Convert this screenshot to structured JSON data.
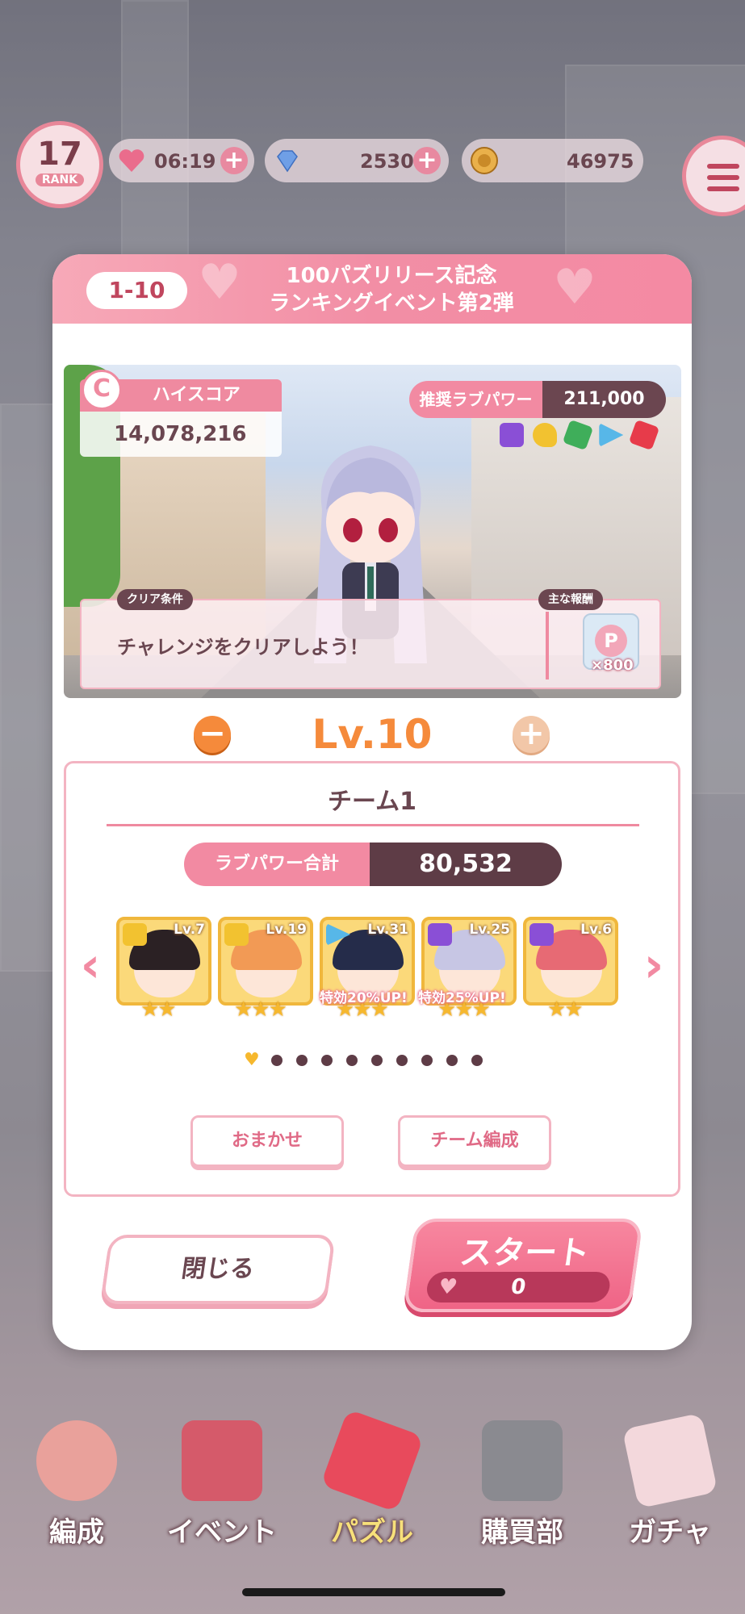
{
  "hud": {
    "rank_value": "17",
    "rank_label": "RANK",
    "stamina": "06:19",
    "gems": "2530",
    "coins": "46975"
  },
  "modal": {
    "stage": "1-10",
    "title_line1": "100パズリリース記念",
    "title_line2": "ランキングイベント第2弾",
    "highscore_label": "ハイスコア",
    "highscore_rank": "C",
    "highscore_value": "14,078,216",
    "recommended_label": "推奨ラブパワー",
    "recommended_value": "211,000",
    "clear_tag": "クリア条件",
    "clear_text": "チャレンジをクリアしよう！",
    "reward_tag": "主な報酬",
    "reward_icon": "P",
    "reward_amount": "×800",
    "level": "Lv.10",
    "team_name": "チーム1",
    "power_label": "ラブパワー合計",
    "power_value": "80,532",
    "cards": [
      {
        "level": "Lv.7",
        "stars": "★★",
        "boost": ""
      },
      {
        "level": "Lv.19",
        "stars": "★★★",
        "boost": ""
      },
      {
        "level": "Lv.31",
        "stars": "★★★",
        "boost": "特効20%UP!"
      },
      {
        "level": "Lv.25",
        "stars": "★★★",
        "boost": "特効25%UP!"
      },
      {
        "level": "Lv.6",
        "stars": "★★",
        "boost": ""
      }
    ],
    "auto_button": "おまかせ",
    "edit_button": "チーム編成",
    "close_button": "閉じる",
    "start_button": "スタート",
    "start_cost": "0"
  },
  "nav": {
    "items": [
      {
        "label": "編成"
      },
      {
        "label": "イベント"
      },
      {
        "label": "パズル"
      },
      {
        "label": "購買部"
      },
      {
        "label": "ガチャ"
      }
    ]
  },
  "colors": {
    "accent_pink": "#f28aa2",
    "dark_brown": "#5e3c46",
    "level_orange": "#f58a3b"
  }
}
